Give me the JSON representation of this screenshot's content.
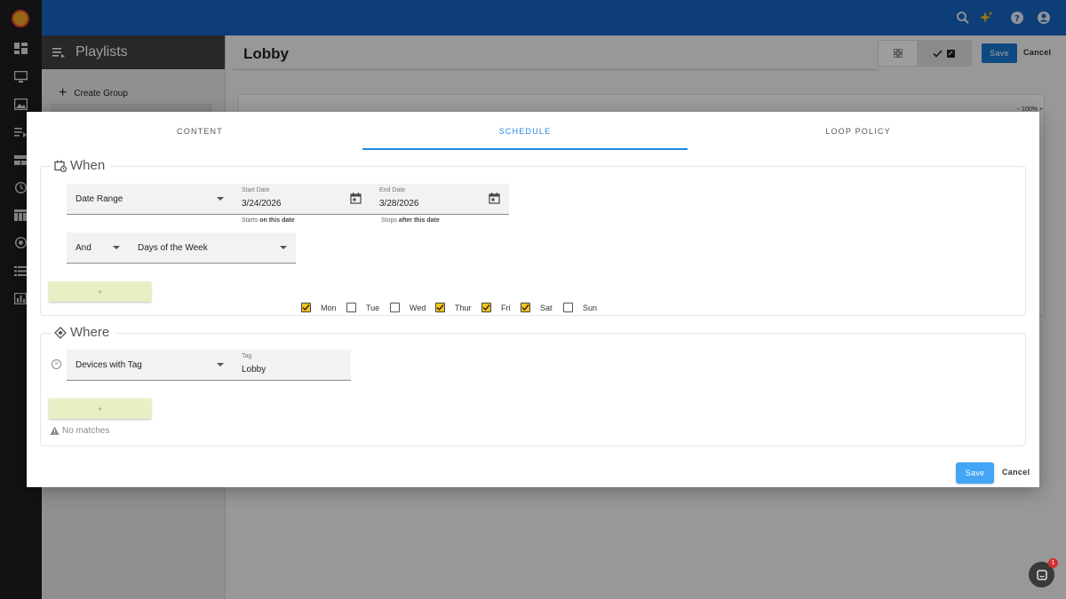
{
  "colors": {
    "topbar": "#1565c0",
    "accent": "#1e88e5",
    "checkbox": "#f7c516",
    "rail": "#1e1e1e"
  },
  "playlists_panel": {
    "title": "Playlists",
    "create_group": "Create Group"
  },
  "main": {
    "title": "Lobby",
    "save": "Save",
    "cancel": "Cancel",
    "zoom": "100%"
  },
  "dialog": {
    "tabs": [
      {
        "label": "CONTENT",
        "active": false
      },
      {
        "label": "SCHEDULE",
        "active": true
      },
      {
        "label": "LOOP POLICY",
        "active": false
      }
    ],
    "when": {
      "legend": "When",
      "range_type": "Date Range",
      "start_date": {
        "label": "Start Date",
        "value": "3/24/2026",
        "hint_prefix": "Starts ",
        "hint_bold": "on this date"
      },
      "end_date": {
        "label": "End Date",
        "value": "3/28/2026",
        "hint_prefix": "Stops ",
        "hint_bold": "after this date"
      },
      "conjunction": "And",
      "rule_type": "Days of the Week",
      "days": [
        {
          "label": "Mon",
          "checked": true
        },
        {
          "label": "Tue",
          "checked": false
        },
        {
          "label": "Wed",
          "checked": false
        },
        {
          "label": "Thur",
          "checked": true
        },
        {
          "label": "Fri",
          "checked": true
        },
        {
          "label": "Sat",
          "checked": true
        },
        {
          "label": "Sun",
          "checked": false
        }
      ],
      "add_label": "+"
    },
    "where": {
      "legend": "Where",
      "target_type": "Devices with Tag",
      "tag": {
        "label": "Tag",
        "value": "Lobby"
      },
      "add_label": "+",
      "no_matches": "No matches"
    },
    "save": "Save",
    "cancel": "Cancel"
  },
  "chat": {
    "badge": "1"
  }
}
